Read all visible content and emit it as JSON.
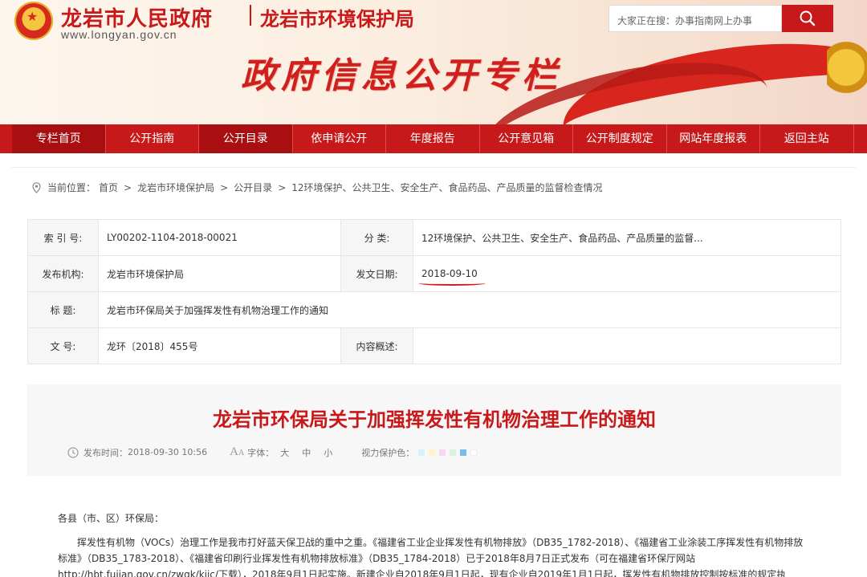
{
  "header": {
    "site_name": "龙岩市人民政府",
    "bureau_name": "龙岩市环境保护局",
    "site_url": "www.longyan.gov.cn",
    "column_title": "政府信息公开专栏",
    "search_placeholder": "大家正在搜：办事指南网上办事",
    "search_icon": "search-icon",
    "emblem_icon": "national-emblem-icon"
  },
  "nav": {
    "items": [
      {
        "label": "专栏首页"
      },
      {
        "label": "公开指南"
      },
      {
        "label": "公开目录"
      },
      {
        "label": "依申请公开"
      },
      {
        "label": "年度报告"
      },
      {
        "label": "公开意见箱"
      },
      {
        "label": "公开制度规定"
      },
      {
        "label": "网站年度报表"
      },
      {
        "label": "返回主站"
      }
    ]
  },
  "breadcrumb": {
    "prefix": "当前位置：",
    "items": [
      "首页",
      "龙岩市环境保护局",
      "公开目录",
      "12环境保护、公共卫生、安全生产、食品药品、产品质量的监督检查情况"
    ],
    "separator": ">"
  },
  "info": {
    "index_label": "索 引 号:",
    "index_value": "LY00202-1104-2018-00021",
    "category_label": "分      类:",
    "category_value": "12环境保护、公共卫生、安全生产、食品药品、产品质量的监督...",
    "publisher_label": "发布机构:",
    "publisher_value": "龙岩市环境保护局",
    "issue_date_label": "发文日期:",
    "issue_date_value": "2018-09-10",
    "title_label": "标      题:",
    "title_value": "龙岩市环保局关于加强挥发性有机物治理工作的通知",
    "doc_no_label": "文      号:",
    "doc_no_value": "龙环〔2018〕455号",
    "summary_label": "内容概述:",
    "summary_value": ""
  },
  "article": {
    "title": "龙岩市环保局关于加强挥发性有机物治理工作的通知",
    "publish_time_label": "发布时间：",
    "publish_time": "2018-09-30 10:56",
    "font_label": "字体：",
    "font_large": "大",
    "font_medium": "中",
    "font_small": "小",
    "eye_care_label": "视力保护色：",
    "eye_care_colors": [
      "#e7f4fb",
      "#fdf6d6",
      "#f5e3f3",
      "#e1f3e6",
      "#8ac4f0",
      "#ffffff"
    ],
    "salutation": "各县（市、区）环保局：",
    "paragraph_1": "挥发性有机物（VOCs）治理工作是我市打好蓝天保卫战的重中之重。《福建省工业企业挥发性有机物排放》（DB35_1782-2018）、《福建省工业涂装工序挥发性有机物排放标准》（DB35_1783-2018）、《福建省印刷行业挥发性有机物排放标准》（DB35_1784-2018）已于2018年8月7日正式发布（可在福建省环保厅网站http://hbt.fujian.gov.cn/zwgk/kjjc/下载），2018年9月1日起实施。新建企业自2018年9月1日起，现有企业自2019年1月1日起，挥发性有机物排放控制按标准的规定执"
  },
  "colors": {
    "brand_red": "#c8191a",
    "nav_active": "#a90f10"
  }
}
